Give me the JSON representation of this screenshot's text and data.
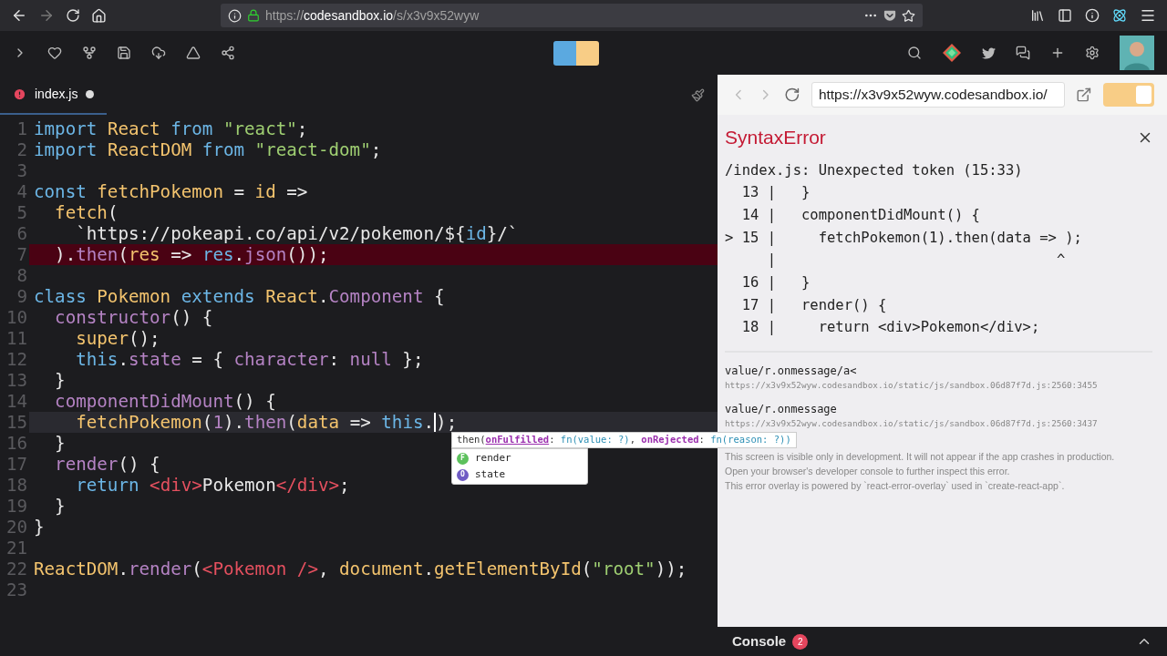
{
  "browser": {
    "url": {
      "scheme": "https://",
      "host": "codesandbox.io",
      "path": "/s/x3v9x52wyw"
    }
  },
  "editor": {
    "tab": {
      "label": "index.js",
      "error": true,
      "unsaved": true
    },
    "lines": [
      {
        "number": "1",
        "error": false,
        "current": false,
        "tokens": [
          {
            "text": "import ",
            "kind": "kw"
          },
          {
            "text": "React ",
            "kind": "id"
          },
          {
            "text": "from ",
            "kind": "kw"
          },
          {
            "text": "\"react\"",
            "kind": "str"
          },
          {
            "text": ";",
            "kind": "pl"
          }
        ]
      },
      {
        "number": "2",
        "error": false,
        "current": false,
        "tokens": [
          {
            "text": "import ",
            "kind": "kw"
          },
          {
            "text": "ReactDOM ",
            "kind": "id"
          },
          {
            "text": "from ",
            "kind": "kw"
          },
          {
            "text": "\"react-dom\"",
            "kind": "str"
          },
          {
            "text": ";",
            "kind": "pl"
          }
        ]
      },
      {
        "number": "3",
        "error": false,
        "current": false
      },
      {
        "number": "4",
        "error": false,
        "current": false,
        "tokens": [
          {
            "text": "const ",
            "kind": "kw"
          },
          {
            "text": "fetchPokemon",
            "kind": "id"
          },
          {
            "text": " = ",
            "kind": "pl"
          },
          {
            "text": "id",
            "kind": "id"
          },
          {
            "text": " =>",
            "kind": "pl"
          }
        ]
      },
      {
        "number": "5",
        "error": false,
        "current": false,
        "tokens": [
          {
            "text": "  fetch",
            "kind": "id"
          },
          {
            "text": "(",
            "kind": "pl"
          }
        ]
      },
      {
        "number": "6",
        "error": false,
        "current": false,
        "tokens": [
          {
            "text": "    `https://pokeapi.co/api/v2/pokemon/${",
            "kind": "pl"
          },
          {
            "text": "id",
            "kind": "kw"
          },
          {
            "text": "}/`",
            "kind": "pl"
          }
        ]
      },
      {
        "number": "7",
        "error": true,
        "current": false,
        "tokens": [
          {
            "text": "  ).",
            "kind": "pl"
          },
          {
            "text": "then",
            "kind": "fn"
          },
          {
            "text": "(",
            "kind": "pl"
          },
          {
            "text": "res",
            "kind": "id"
          },
          {
            "text": " => ",
            "kind": "pl"
          },
          {
            "text": "res",
            "kind": "kw"
          },
          {
            "text": ".",
            "kind": "pl"
          },
          {
            "text": "json",
            "kind": "fn"
          },
          {
            "text": "());",
            "kind": "pl"
          }
        ]
      },
      {
        "number": "8",
        "error": false,
        "current": false
      },
      {
        "number": "9",
        "error": false,
        "current": false,
        "tokens": [
          {
            "text": "class ",
            "kind": "kw"
          },
          {
            "text": "Pokemon ",
            "kind": "id"
          },
          {
            "text": "extends ",
            "kind": "kw"
          },
          {
            "text": "React",
            "kind": "id"
          },
          {
            "text": ".",
            "kind": "pl"
          },
          {
            "text": "Component",
            "kind": "fn"
          },
          {
            "text": " {",
            "kind": "pl"
          }
        ]
      },
      {
        "number": "10",
        "error": false,
        "current": false,
        "tokens": [
          {
            "text": "  constructor",
            "kind": "fn"
          },
          {
            "text": "() {",
            "kind": "pl"
          }
        ]
      },
      {
        "number": "11",
        "error": false,
        "current": false,
        "tokens": [
          {
            "text": "    super",
            "kind": "id"
          },
          {
            "text": "();",
            "kind": "pl"
          }
        ]
      },
      {
        "number": "12",
        "error": false,
        "current": false,
        "tokens": [
          {
            "text": "    this",
            "kind": "kw"
          },
          {
            "text": ".",
            "kind": "pl"
          },
          {
            "text": "state",
            "kind": "fn"
          },
          {
            "text": " = { ",
            "kind": "pl"
          },
          {
            "text": "character",
            "kind": "fn"
          },
          {
            "text": ": ",
            "kind": "pl"
          },
          {
            "text": "null",
            "kind": "fn"
          },
          {
            "text": " };",
            "kind": "pl"
          }
        ]
      },
      {
        "number": "13",
        "error": false,
        "current": false,
        "tokens": [
          {
            "text": "  }",
            "kind": "pl"
          }
        ]
      },
      {
        "number": "14",
        "error": false,
        "current": false,
        "tokens": [
          {
            "text": "  componentDidMount",
            "kind": "fn"
          },
          {
            "text": "() {",
            "kind": "pl"
          }
        ]
      },
      {
        "number": "15",
        "error": false,
        "current": true,
        "tokens": [
          {
            "text": "    fetchPokemon",
            "kind": "id"
          },
          {
            "text": "(",
            "kind": "pl"
          },
          {
            "text": "1",
            "kind": "num"
          },
          {
            "text": ").",
            "kind": "pl"
          },
          {
            "text": "then",
            "kind": "fn"
          },
          {
            "text": "(",
            "kind": "pl"
          },
          {
            "text": "data",
            "kind": "id"
          },
          {
            "text": " => ",
            "kind": "pl"
          },
          {
            "text": "this",
            "kind": "kw"
          },
          {
            "text": ".",
            "kind": "pl"
          },
          {
            "text": ");",
            "kind": "pl"
          }
        ]
      },
      {
        "number": "16",
        "error": false,
        "current": false,
        "tokens": [
          {
            "text": "  }",
            "kind": "pl"
          }
        ]
      },
      {
        "number": "17",
        "error": false,
        "current": false,
        "tokens": [
          {
            "text": "  render",
            "kind": "fn"
          },
          {
            "text": "() {",
            "kind": "pl"
          }
        ]
      },
      {
        "number": "18",
        "error": false,
        "current": false,
        "tokens": [
          {
            "text": "    return ",
            "kind": "kw"
          },
          {
            "text": "<div>",
            "kind": "tag"
          },
          {
            "text": "Pokemon",
            "kind": "pl"
          },
          {
            "text": "</div>",
            "kind": "tag"
          },
          {
            "text": ";",
            "kind": "pl"
          }
        ]
      },
      {
        "number": "19",
        "error": false,
        "current": false,
        "tokens": [
          {
            "text": "  }",
            "kind": "pl"
          }
        ]
      },
      {
        "number": "20",
        "error": false,
        "current": false,
        "tokens": [
          {
            "text": "}",
            "kind": "pl"
          }
        ]
      },
      {
        "number": "21",
        "error": false,
        "current": false
      },
      {
        "number": "22",
        "error": false,
        "current": false,
        "tokens": [
          {
            "text": "ReactDOM",
            "kind": "id"
          },
          {
            "text": ".",
            "kind": "pl"
          },
          {
            "text": "render",
            "kind": "fn"
          },
          {
            "text": "(",
            "kind": "pl"
          },
          {
            "text": "<Pokemon />",
            "kind": "tag"
          },
          {
            "text": ", ",
            "kind": "pl"
          },
          {
            "text": "document",
            "kind": "id"
          },
          {
            "text": ".",
            "kind": "pl"
          },
          {
            "text": "getElementById",
            "kind": "id"
          },
          {
            "text": "(",
            "kind": "pl"
          },
          {
            "text": "\"root\"",
            "kind": "str"
          },
          {
            "text": "));",
            "kind": "pl"
          }
        ]
      },
      {
        "number": "23",
        "error": false,
        "current": false
      }
    ],
    "autocomplete": {
      "signature": [
        {
          "text": "then(",
          "kind": "plain"
        },
        {
          "text": "onFulfilled",
          "kind": "active-param"
        },
        {
          "text": ": ",
          "kind": "plain"
        },
        {
          "text": "fn(value: ?)",
          "kind": "type"
        },
        {
          "text": ", ",
          "kind": "plain"
        },
        {
          "text": "onRejected",
          "kind": "param"
        },
        {
          "text": ": ",
          "kind": "plain"
        },
        {
          "text": "fn(reason: ?))",
          "kind": "type"
        }
      ],
      "items": [
        {
          "letter": "F",
          "label": "render",
          "color": "#5cc15c"
        },
        {
          "letter": "O",
          "label": "state",
          "color": "#6f5bc4"
        }
      ]
    }
  },
  "preview": {
    "url": "https://x3v9x52wyw.codesandbox.io/",
    "toggle": {
      "on": true
    },
    "error": {
      "title": "SyntaxError",
      "message": "/index.js: Unexpected token (15:33)",
      "frame": [
        "  13 |   }",
        "  14 |   componentDidMount() {",
        "> 15 |     fetchPokemon(1).then(data => );",
        "     |                                 ^",
        "  16 |   }",
        "  17 |   render() {",
        "  18 |     return <div>Pokemon</div>;"
      ],
      "stack": [
        {
          "function": "value/r.onmessage/a<",
          "url": "https://x3v9x52wyw.codesandbox.io/static/js/sandbox.06d87f7d.js:2560:3455"
        },
        {
          "function": "value/r.onmessage",
          "url": "https://x3v9x52wyw.codesandbox.io/static/js/sandbox.06d87f7d.js:2560:3437"
        }
      ],
      "footer": [
        "This screen is visible only in development. It will not appear if the app crashes in production.",
        "Open your browser's developer console to further inspect this error.",
        "This error overlay is powered by `react-error-overlay` used in `create-react-app`."
      ]
    },
    "console": {
      "label": "Console",
      "count": "2"
    }
  }
}
